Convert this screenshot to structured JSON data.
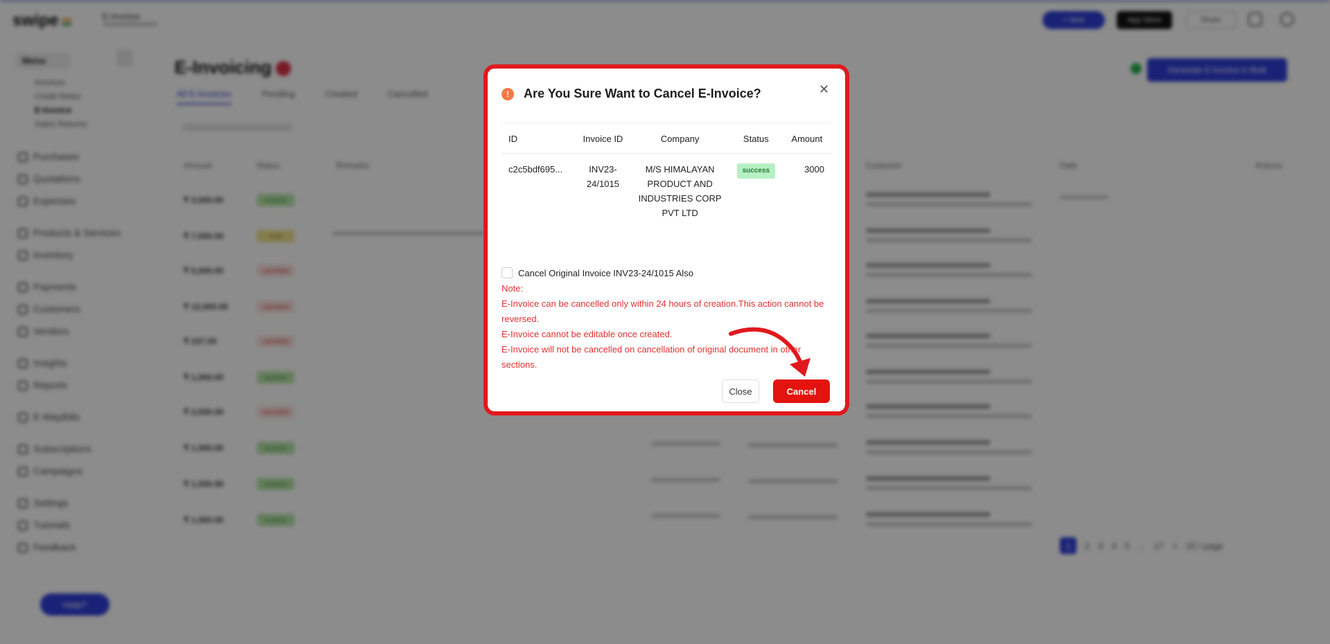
{
  "app": {
    "logo": "swipe",
    "company_name": "E-Invoice",
    "new_button": "+ New",
    "store_button": "App Store",
    "share_button": "Share"
  },
  "sidebar": {
    "menu_title": "Menu",
    "sub_items": [
      "Invoices",
      "Credit Notes",
      "E-Invoice",
      "Sales Returns"
    ],
    "items": [
      "Purchases",
      "Quotations",
      "Expenses",
      "Products & Services",
      "Inventory",
      "Payments",
      "Customers",
      "Vendors",
      "Insights",
      "Reports",
      "E-WayBills",
      "Subscriptions",
      "Campaigns",
      "Settings",
      "Tutorials",
      "Feedback"
    ],
    "help_button": "Help?"
  },
  "main": {
    "title": "E-Invoicing",
    "tabs": [
      "All E-Invoices",
      "Pending",
      "Created",
      "Cancelled"
    ],
    "bulk_button": "Generate E-Invoice in Bulk",
    "columns": [
      "Amount",
      "Status",
      "Remarks",
      "Customer",
      "Date",
      "Actions"
    ],
    "rows": [
      {
        "amount": "₹ 3,000.00",
        "status": "success"
      },
      {
        "amount": "₹ 7,000.00",
        "status": "draft"
      },
      {
        "amount": "₹ 5,000.00",
        "status": "cancelled"
      },
      {
        "amount": "₹ 12,000.00",
        "status": "cancelled"
      },
      {
        "amount": "₹ 237.00",
        "status": "cancelled"
      },
      {
        "amount": "₹ 1,000.00",
        "status": "success"
      },
      {
        "amount": "₹ 2,000.00",
        "status": "cancelled"
      },
      {
        "amount": "₹ 1,000.00",
        "status": "success"
      },
      {
        "amount": "₹ 1,000.00",
        "status": "success"
      },
      {
        "amount": "₹ 1,000.00",
        "status": "success"
      }
    ],
    "pagination": [
      "1",
      "2",
      "3",
      "4",
      "5",
      "...",
      "17",
      ">",
      "10 / page"
    ]
  },
  "modal": {
    "title": "Are You Sure Want to Cancel E-Invoice?",
    "close_icon": "close-icon",
    "warning_icon": "info-circle-icon",
    "table": {
      "headers": [
        "ID",
        "Invoice ID",
        "Company",
        "Status",
        "Amount"
      ],
      "row": {
        "id": "c2c5bdf695...",
        "invoice_id": "INV23-24/1015",
        "company": "M/S HIMALAYAN PRODUCT AND INDUSTRIES CORP PVT LTD",
        "status": "success",
        "amount": "3000"
      }
    },
    "checkbox_label": "Cancel Original Invoice INV23-24/1015 Also",
    "notes": [
      "Note:",
      "E-Invoice can be cancelled only within 24 hours of creation.This action cannot be reversed.",
      "E-Invoice cannot be editable once created.",
      "E-Invoice will not be cancelled on cancellation of original document in other sections."
    ],
    "close_button": "Close",
    "cancel_button": "Cancel"
  },
  "colors": {
    "brand": "#2f3ed8",
    "danger": "#e3140f",
    "highlight_frame": "#e0191d",
    "success_pill": "#b7f0c4",
    "note_text": "#e03131"
  }
}
